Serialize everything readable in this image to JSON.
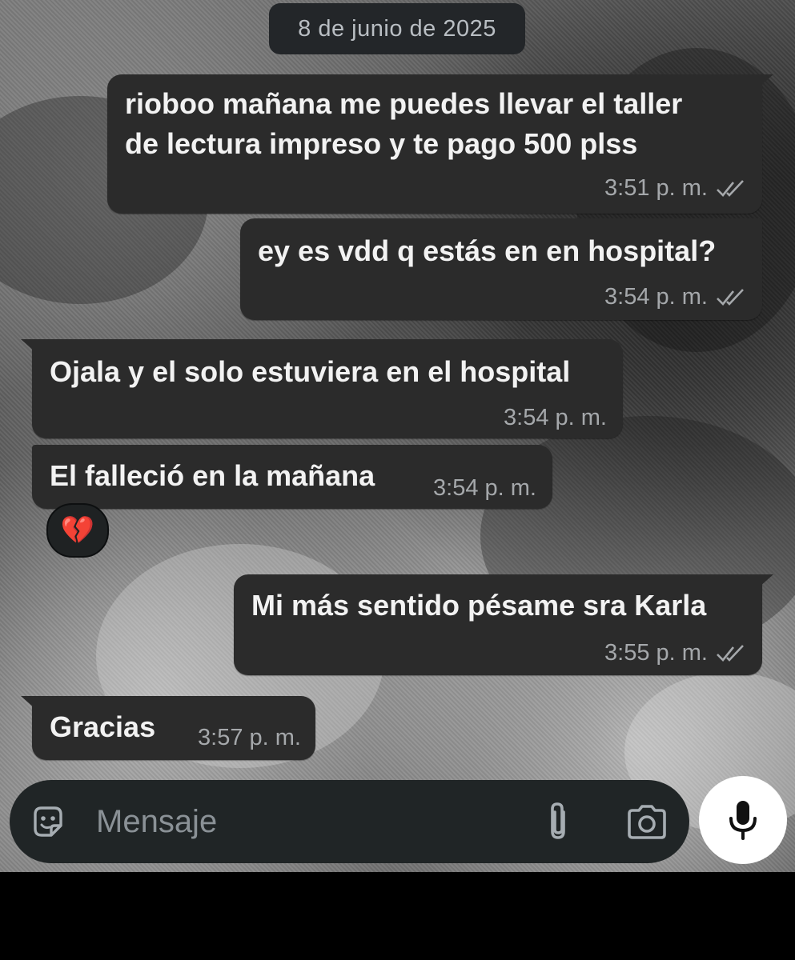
{
  "date_chip": "8 de junio de 2025",
  "messages": [
    {
      "direction": "out",
      "lines": [
        "rioboo mañana me puedes llevar el taller",
        "de lectura impreso y te pago 500 plss"
      ],
      "time": "3:51 p. m.",
      "status": "read-double-check"
    },
    {
      "direction": "out",
      "lines": [
        "ey es vdd q estás en en hospital?"
      ],
      "time": "3:54 p. m.",
      "status": "read-double-check"
    },
    {
      "direction": "in",
      "lines": [
        "Ojala y el solo estuviera en el hospital"
      ],
      "time": "3:54 p. m."
    },
    {
      "direction": "in",
      "lines": [
        "El falleció en la mañana"
      ],
      "time": "3:54 p. m.",
      "reaction": "💔"
    },
    {
      "direction": "out",
      "lines": [
        "Mi más sentido pésame sra Karla"
      ],
      "time": "3:55 p. m.",
      "status": "read-double-check"
    },
    {
      "direction": "in",
      "lines": [
        "Gracias"
      ],
      "time": "3:57 p. m."
    }
  ],
  "composer": {
    "placeholder": "Mensaje",
    "icons": [
      "sticker-icon",
      "paperclip-icon",
      "camera-icon",
      "microphone-icon"
    ]
  },
  "colors": {
    "bubble": "#2b2b2b",
    "composer": "#202526",
    "mic_button": "#ffffff",
    "meta_text": "#a5a8ab"
  }
}
